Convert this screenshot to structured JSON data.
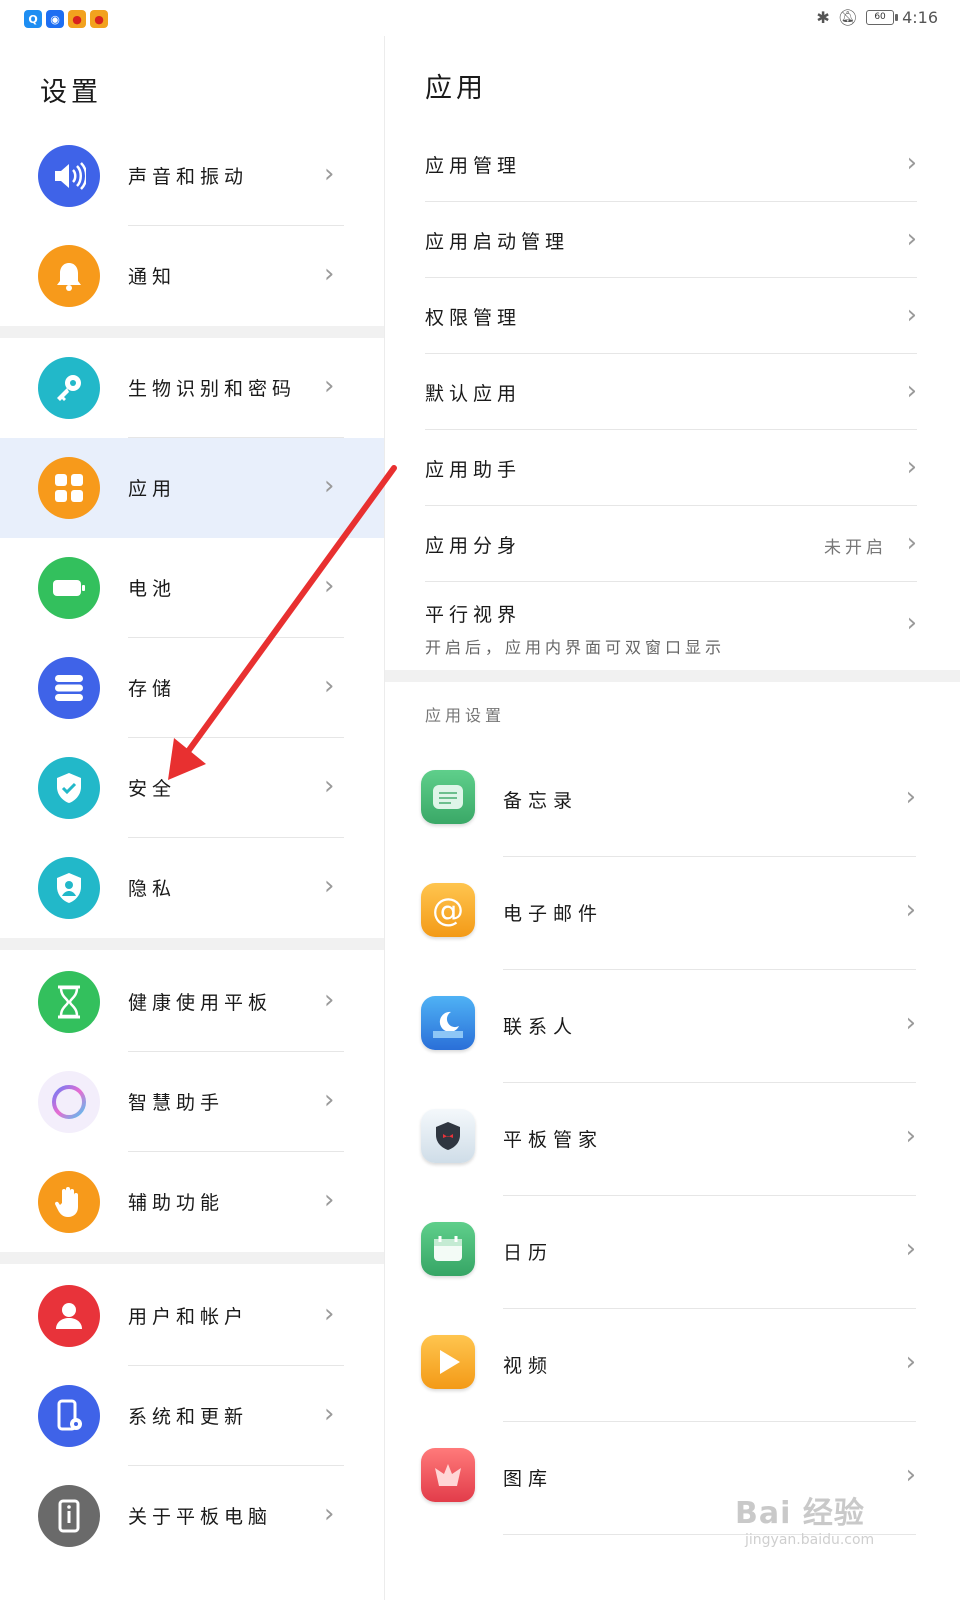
{
  "status_bar": {
    "app_icons": [
      "qq-icon",
      "bulb-app-icon",
      "weibo-icon",
      "weibo-icon"
    ],
    "bluetooth_icon": "bluetooth-icon",
    "mute_icon": "bell-off-icon",
    "battery": "60",
    "time": "4:16"
  },
  "left": {
    "title": "设置",
    "items": [
      {
        "label": "声音和振动",
        "icon": "speaker-icon",
        "color": "#3f63e8"
      },
      {
        "label": "通知",
        "icon": "bell-icon",
        "color": "#f79a1b"
      },
      {
        "label": "生物识别和密码",
        "icon": "key-icon",
        "color": "#22b8c9"
      },
      {
        "label": "应用",
        "icon": "apps-grid-icon",
        "color": "#f79a1b"
      },
      {
        "label": "电池",
        "icon": "battery-icon",
        "color": "#33c05d"
      },
      {
        "label": "存储",
        "icon": "storage-icon",
        "color": "#3f63e8"
      },
      {
        "label": "安全",
        "icon": "shield-check-icon",
        "color": "#22b8c9"
      },
      {
        "label": "隐私",
        "icon": "privacy-shield-icon",
        "color": "#22b8c9"
      },
      {
        "label": "健康使用平板",
        "icon": "hourglass-icon",
        "color": "#33c05d"
      },
      {
        "label": "智慧助手",
        "icon": "assistant-ring-icon",
        "color": "#e8e0f6"
      },
      {
        "label": "辅助功能",
        "icon": "hand-icon",
        "color": "#f79a1b"
      },
      {
        "label": "用户和帐户",
        "icon": "user-icon",
        "color": "#e8333a"
      },
      {
        "label": "系统和更新",
        "icon": "phone-gear-icon",
        "color": "#3f63e8"
      },
      {
        "label": "关于平板电脑",
        "icon": "info-phone-icon",
        "color": "#6a6a6a"
      }
    ]
  },
  "right": {
    "title": "应用",
    "items": [
      {
        "label": "应用管理"
      },
      {
        "label": "应用启动管理"
      },
      {
        "label": "权限管理"
      },
      {
        "label": "默认应用"
      },
      {
        "label": "应用助手"
      },
      {
        "label": "应用分身",
        "status": "未开启"
      },
      {
        "label": "平行视界",
        "sub": "开启后，应用内界面可双窗口显示"
      }
    ],
    "section_title": "应用设置",
    "apps": [
      {
        "label": "备忘录",
        "icon": "notepad-icon"
      },
      {
        "label": "电子邮件",
        "icon": "email-at-icon"
      },
      {
        "label": "联系人",
        "icon": "contacts-moon-icon"
      },
      {
        "label": "平板管家",
        "icon": "tablet-manager-icon"
      },
      {
        "label": "日历",
        "icon": "calendar-icon"
      },
      {
        "label": "视频",
        "icon": "video-play-icon"
      },
      {
        "label": "图库",
        "icon": "gallery-icon"
      }
    ]
  },
  "watermark": {
    "text": "Bai 经验",
    "sub": "jingyan.baidu.com"
  }
}
